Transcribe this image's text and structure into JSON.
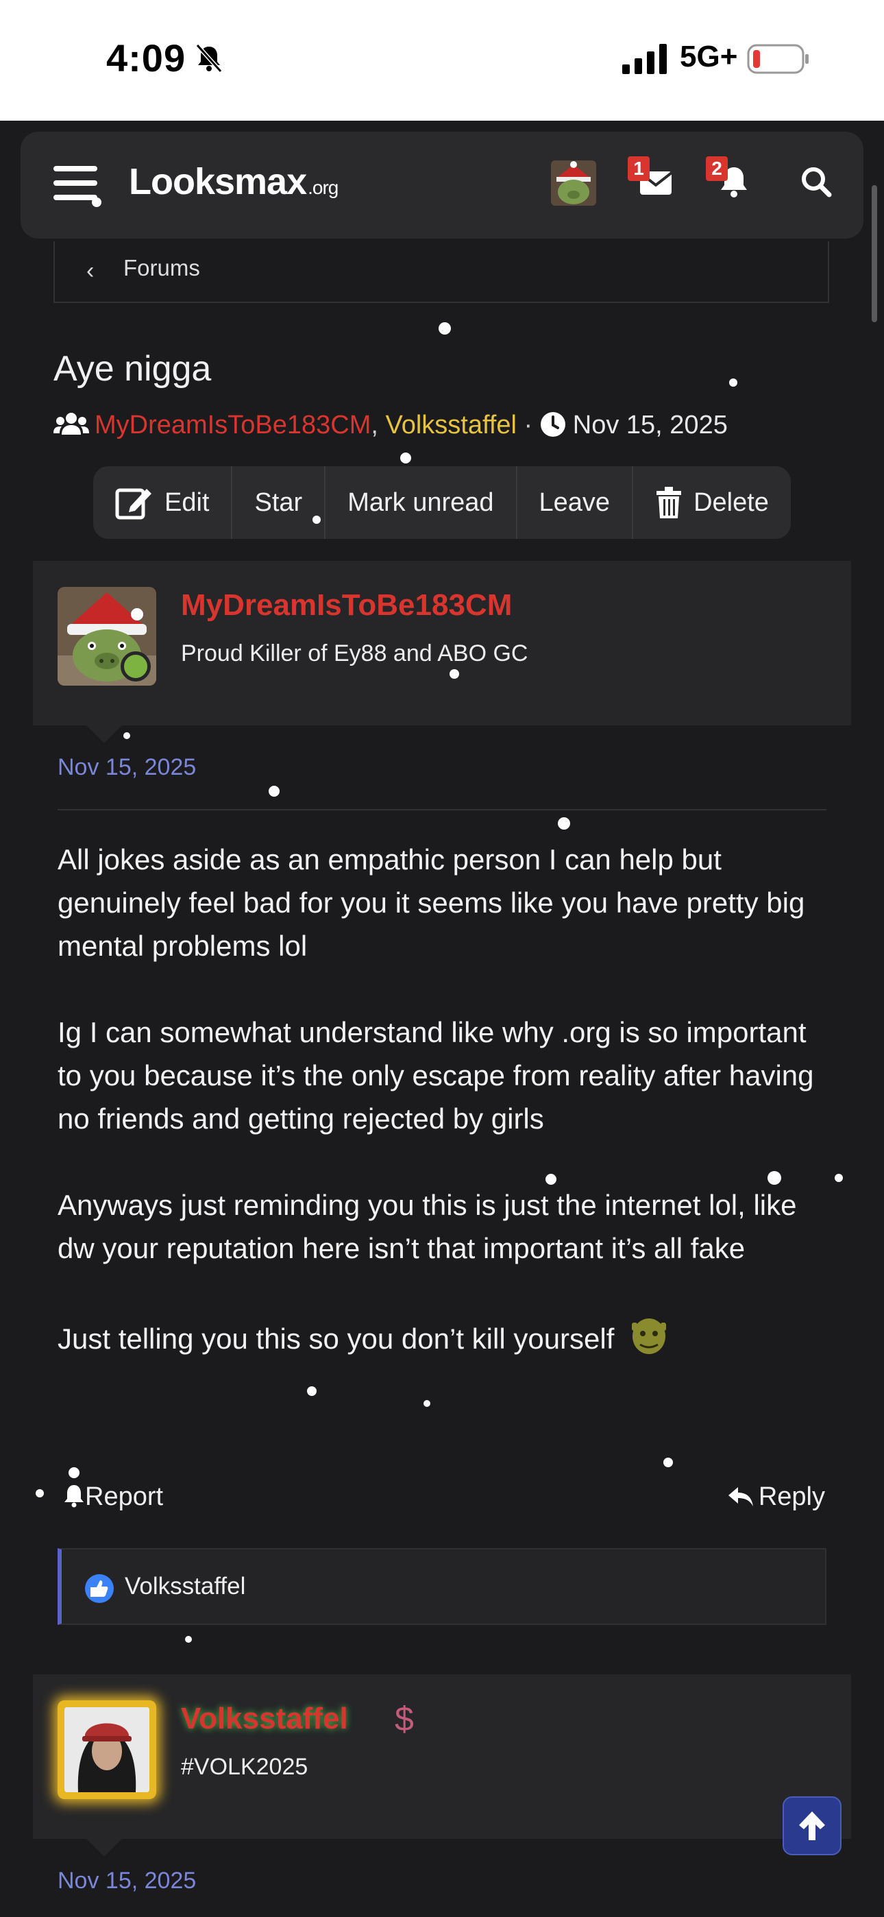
{
  "status_bar": {
    "time": "4:09",
    "network": "5G+"
  },
  "header": {
    "logo_main": "Looksmax",
    "logo_suffix": ".org",
    "inbox_badge": "1",
    "alerts_badge": "2"
  },
  "breadcrumb": {
    "label": "Forums"
  },
  "thread": {
    "title": "Aye nigga",
    "participant_1": "MyDreamIsToBe183CM",
    "comma": ", ",
    "participant_2": "Volksstaffel",
    "dot": " · ",
    "date": "Nov 15, 2025"
  },
  "actions": {
    "edit": "Edit",
    "star": "Star",
    "mark_unread": "Mark unread",
    "leave": "Leave",
    "delete": "Delete"
  },
  "post1": {
    "author": "MyDreamIsToBe183CM",
    "user_title": "Proud Killer of Ey88 and ABO GC",
    "date": "Nov 15, 2025",
    "paragraphs": [
      "All jokes aside as an empathic person I can help but genuinely feel bad for you it seems like you have pretty big mental problems lol",
      "Ig I can somewhat understand like why .org is so important to you because it’s the only escape from reality after having no friends and getting rejected by girls",
      "Anyways just reminding you this is just the internet lol, like dw your reputation here isn’t that important it’s all fake",
      "Just telling you this so you don’t kill yourself"
    ],
    "report": "Report",
    "reply": "Reply",
    "liked_by": "Volksstaffel"
  },
  "post2": {
    "author": "Volksstaffel",
    "user_title": "#VOLK2025",
    "date": "Nov 15, 2025",
    "dollar": "$"
  },
  "colors": {
    "accent_red": "#d9352f",
    "gold": "#e6c341",
    "link_blue": "#7a86d6",
    "background": "#1b1b1d"
  }
}
